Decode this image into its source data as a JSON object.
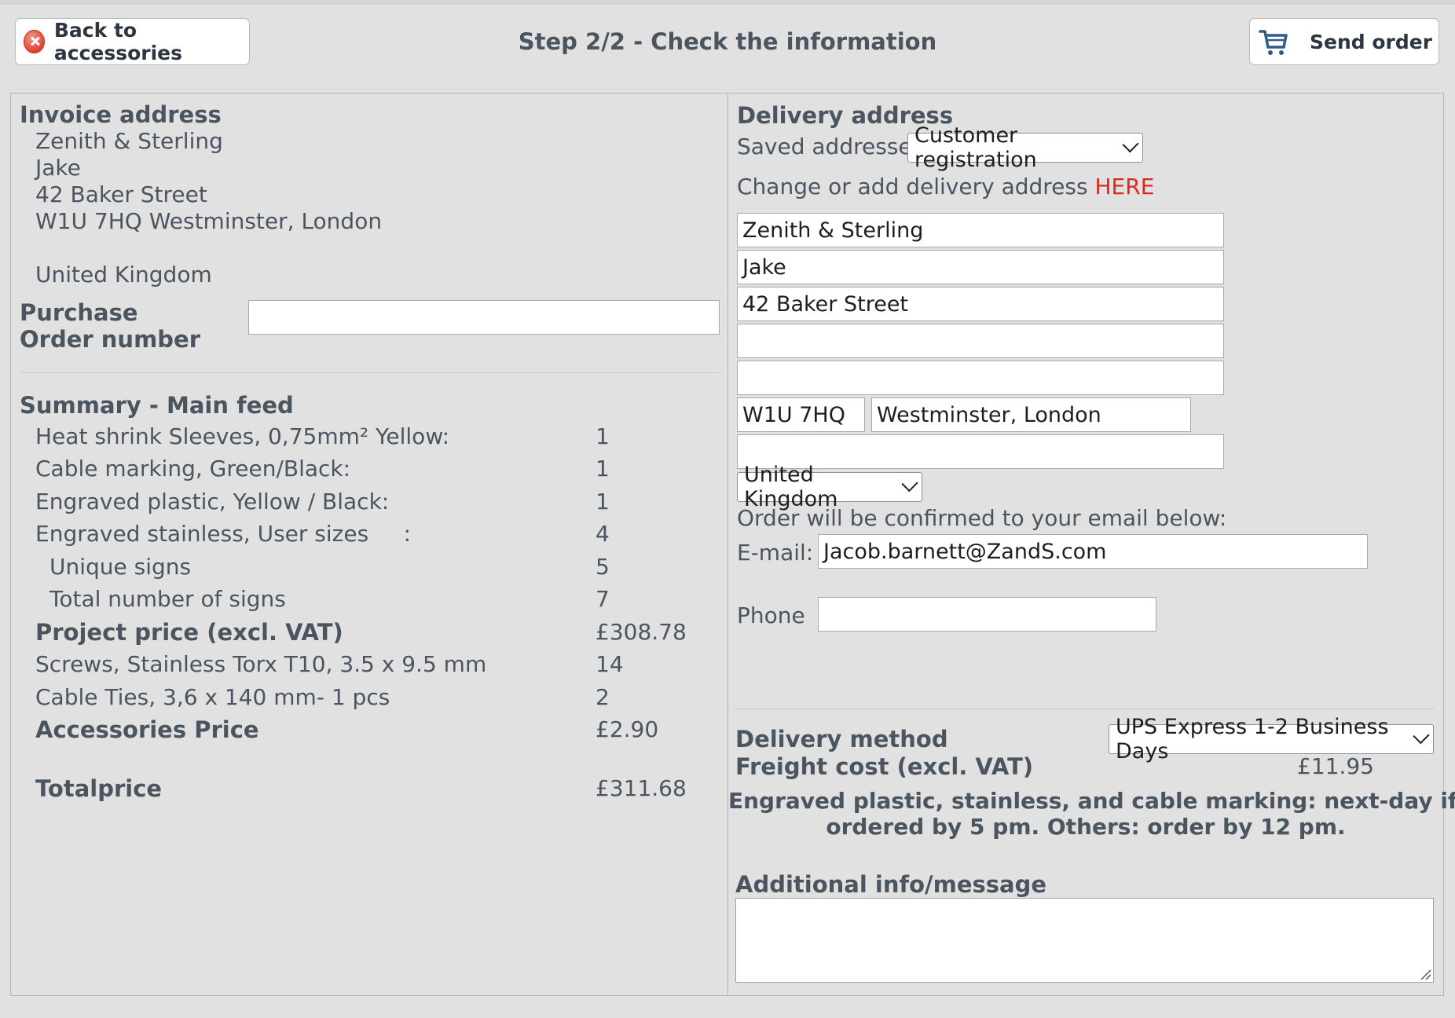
{
  "header": {
    "back_label": "Back to accessories",
    "step_title": "Step 2/2 - Check the information",
    "send_label": "Send order"
  },
  "invoice": {
    "heading": "Invoice address",
    "lines": [
      "Zenith & Sterling",
      "Jake",
      "42 Baker Street",
      "W1U 7HQ Westminster, London",
      "United Kingdom"
    ],
    "po_label_line1": "Purchase",
    "po_label_line2": "Order number",
    "po_value": ""
  },
  "summary": {
    "heading": "Summary - Main feed",
    "rows": [
      {
        "label": "Heat shrink Sleeves, 0,75mm² Yellow:",
        "value": "1"
      },
      {
        "label": "Cable marking, Green/Black:",
        "value": "1"
      },
      {
        "label": "Engraved plastic, Yellow / Black:",
        "value": "1"
      },
      {
        "label": "Engraved stainless, User sizes     :",
        "value": "4"
      },
      {
        "label": "Unique signs",
        "value": "5"
      },
      {
        "label": "Total number of signs",
        "value": "7"
      },
      {
        "label": "Project price (excl. VAT)",
        "value": "£308.78"
      },
      {
        "label": "Screws, Stainless Torx T10, 3.5 x 9.5 mm",
        "value": "14"
      },
      {
        "label": "Cable Ties, 3,6 x 140 mm- 1 pcs",
        "value": "2"
      },
      {
        "label": "Accessories Price",
        "value": "£2.90"
      },
      {
        "label": "Totalprice",
        "value": "£311.68"
      }
    ]
  },
  "delivery": {
    "heading": "Delivery address",
    "saved_label": "Saved addresses",
    "saved_selected": "Customer registration",
    "change_text": "Change or add delivery address ",
    "change_link": "HERE",
    "fields": {
      "company": "Zenith & Sterling",
      "name": "Jake",
      "street": "42 Baker Street",
      "line4": "",
      "line5": "",
      "postcode": "W1U 7HQ",
      "city": "Westminster, London",
      "line8": ""
    },
    "country_selected": "United Kingdom",
    "confirm_note": "Order will be confirmed to your email below:",
    "email_label": "E-mail:",
    "email_value": "Jacob.barnett@ZandS.com",
    "phone_label": "Phone",
    "phone_value": "",
    "method_label": "Delivery method",
    "method_selected": "UPS Express 1-2 Business Days",
    "freight_label": "Freight cost (excl. VAT)",
    "freight_value": "£11.95",
    "notice_line1": "Engraved plastic, stainless, and cable marking: next-day if",
    "notice_line2": "ordered by 5 pm. Others: order by 12 pm.",
    "message_label": "Additional info/message",
    "message_value": ""
  },
  "colors": {
    "background": "#e1e1e1",
    "link_red": "#e3261b",
    "text": "#4a5560"
  },
  "icons": {
    "back": "close-circle-icon",
    "send": "cart-icon",
    "select": "chevron-down-icon"
  }
}
